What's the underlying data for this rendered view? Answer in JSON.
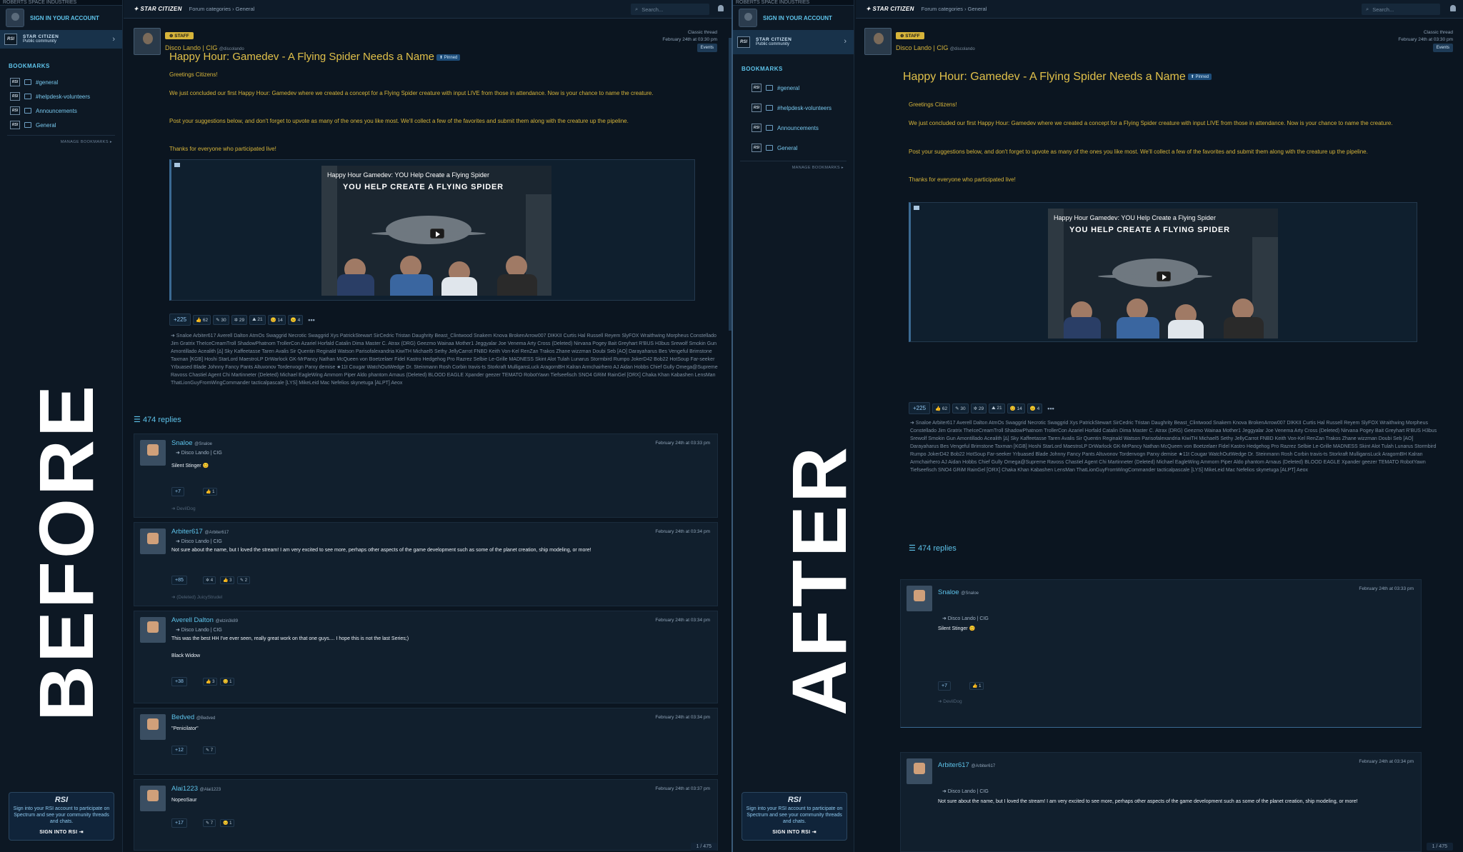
{
  "site": {
    "top": "ROBERTS SPACE INDUSTRIES",
    "signin": "SIGN IN YOUR ACCOUNT",
    "community_name": "STAR CITIZEN",
    "community_sub": "Public community",
    "rsi": "RSI"
  },
  "bookmarks": {
    "title": "BOOKMARKS",
    "items": [
      "#general",
      "#helpdesk-volunteers",
      "Announcements",
      "General"
    ],
    "manage": "MANAGE BOOKMARKS ▸"
  },
  "promo": {
    "logo": "RSI",
    "text": "Sign into your RSI account to participate on Spectrum and see your community threads and chats.",
    "button": "SIGN INTO RSI ⇥"
  },
  "labels": {
    "before": "BEFORE",
    "after": "AFTER"
  },
  "topbar": {
    "logo": "✦ STAR CITIZEN",
    "breadcrumbs": "Forum categories  ›  General",
    "search_placeholder": "Search..."
  },
  "thread": {
    "staff_badge": "⊕ STAFF",
    "author": "Disco Lando | CIG",
    "handle": "@discolando",
    "type": "Classic thread",
    "date": "February 24th at 03:30 pm",
    "tag": "Events",
    "title": "Happy Hour: Gamedev - A Flying Spider Needs a Name",
    "pinned": "⬆ Pinned",
    "greeting": "Greetings Citizens!",
    "p1": "We just concluded our first Happy Hour: Gamedev where we created a concept for a Flying Spider creature with input LIVE from those in attendance. Now is your chance to name the creature.",
    "p2": "Post your suggestions below, and don't forget to upvote as many of the ones you like most. We'll collect a few of the favorites and submit them along with the creature up the pipeline.",
    "p3": "Thanks for everyone who participated live!",
    "video_title": "Happy Hour Gamedev: YOU Help Create a Flying Spider",
    "video_subtitle": "YOU HELP CREATE A FLYING SPIDER",
    "votes": "+225",
    "reactions": [
      "👍 62",
      "✎ 30",
      "✲ 29",
      "⛰ 21",
      "😊 14",
      "😐 4"
    ],
    "more": "•••",
    "voters_before": "➜ Snaloe  Arbiter617  Averell Dalton  AtmOs  Swaggrid  Necrotic  Swaggrid  Xys  PatrickStewart  SirCedric  Tristan Daughrity  Beast_Clintwood  Snakem  Knova  BrokenArrow007  DIKKII  Curtis Hal  Russell Reyem  SlyFOX  Wraithwing  Morpheus  Constellado  Jim Gratrix  TheIceCreamTroll  ShadowPhatnom  TrollerCon  Azariel Horfald  Catalin Dima  Master C. Atrax (DRG)  Geezmo  Wainaa  Mother1  Jeggyalar  Joe Venema  Arty Cross  (Deleted)  Nirvana  Pogey Bait  Greyhart  R'BUS H3bus  Srewolf  Smokin Gun  Amontillado  Acealith  [∆] Sky  Kaffeetasse  Taren Avalis  Sir Quentin Reginald Watson  Parisofalexandria  KiwiTH  Michael5  Sethy  JellyCarrot  FNBD  Keith  Von-Kel  RenZan  Trakos  Zhane  wizzman  Doubi  Seb  [AO] Darayaharus  Bes Vengeful  Brimstone  Taxman [KGB]  Hoshi  StarLord  MaestroLP  DrWarlock  GK-MrPancy  Nathan McQueen  von Boetzelaer  Fidel Kastro  Hedgehog Pro  Razrez  Selbie Le-Grille  MADNESS  Skint Alot  Tulah Lunarus  Stormbird  Rumpo  JokerD42  Bob22  HotSoup  Far-seeker  Yrbuased  Blade  Johnny Fancy Pants  Altuvonov  Tordenvogn  Parxy  demise  ★11t Cougar  WatchOutWedge  Dr. Steinmann  Rosh Corbin  travis-ts  Storkraft  MulligansLuck  AragornBH  Kalran  Armchairhero  AJ  Aidan Hobbs  Chief Gully  Omega@Supreme  Ravoss  Chastiel  Agent Chi  Martinneter  (Deleted)  Michael  EagleWing  Ammorn  Piper  Aldo  phantom Arnaus  (Deleted)  BLOOD EAGLE  Xpander  geezer  TEMATO  RobotYawn  Tiefseefisch  SNO4  GRiM  RainGel  [ORX] Chaka Khan  Kabashen  LensMan  ThatLionGuyFromWingCommander  tacticalpascale  [LYS] MikeLeid  Mac  Nefelios  skynetuga [ALPT]  Aeox",
    "voters_after": "➜ Snaloe  Arbiter617  Averell Dalton  AtmOs  Swaggrid  Necrotic  Swaggrid  Xys  PatrickStewart  SirCedric  Tristan Daughrity  Beast_Clintwood  Snakem  Knova  BrokenArrow007  DIKKII  Curtis Hal  Russell Reyem  SlyFOX  Wraithwing  Morpheus  Constellado  Jim Gratrix  TheIceCreamTroll  ShadowPhatnom  TrollerCon  Azariel Horfald  Catalin Dima  Master C. Atrax (DRG)  Geezmo  Wainaa  Mother1  Jeggyalar  Joe Venema  Arty Cross  (Deleted)  Nirvana  Pogey Bait  Greyhart  R'BUS H3bus  Srewolf  Smokin Gun  Amontillado  Acealith  [∆] Sky  Kaffeetasse  Taren Avalis  Sir Quentin Reginald Watson  Parisofalexandria  KiwiTH  Michael5  Sethy  JellyCarrot  FNBD  Keith  Von-Kel  RenZan  Trakos  Zhane  wizzman  Doubi  Seb  [AO] Darayaharus  Bes Vengeful  Brimstone  Taxman [KGB]  Hoshi  StarLord  MaestroLP  DrWarlock  GK-MrPancy  Nathan McQueen  von Boetzelaer  Fidel Kastro  Hedgehog Pro  Razrez  Selbie Le-Grille  MADNESS  Skint Alot  Tulah Lunarus  Stormbird  Rumpo  JokerD42  Bob22  HotSoup  Far-seeker  Yrbuased  Blade  Johnny Fancy Pants  Altuvonov  Tordenvogn  Parxy  demise  ★11t Cougar  WatchOutWedge  Dr. Steinmann  Rosh Corbin  travis-ts  Storkraft  MulligansLuck  AragornBH  Kalran  Armchairhero  AJ  Aidan Hobbs  Chief Gully  Omega@Supreme  Ravoss  Chastiel  Agent Chi  Martinneter  (Deleted)  Michael  EagleWing  Ammorn  Piper  Aldo  phantom Arnaus  (Deleted)  BLOOD EAGLE  Xpander  geezer  TEMATO  RobotYawn  Tiefseefisch  SNO4  GRiM  RainGel  [ORX] Chaka Khan  Kabashen  LensMan  ThatLionGuyFromWingCommander  tacticalpascale  [LYS] MikeLeid  Mac  Nefelios  skynetuga [ALPT]  Aeox"
  },
  "replies_count": "474 replies",
  "replies": [
    {
      "name": "Snaloe",
      "handle": "@Snaloe",
      "date": "February 24th at 03:33 pm",
      "quote": "➜ Disco Lando | CIG",
      "text": "Silent Stinger 😊",
      "votes": "+7",
      "reactions": [
        "👍 1"
      ],
      "footer": "➜ DevilDog"
    },
    {
      "name": "Arbiter617",
      "handle": "@Arbiter617",
      "date": "February 24th at 03:34 pm",
      "quote": "➜ Disco Lando | CIG",
      "text": "Not sure about the name, but I loved the stream! I am very excited to see more, perhaps other aspects of the game development such as some of the planet creation, ship modeling, or more!",
      "votes": "+85",
      "reactions": [
        "✲ 4",
        "👍 3",
        "✎ 2"
      ],
      "footer": "➜ (Deleted)  JuicyStrudel"
    },
    {
      "name": "Averell Dalton",
      "handle": "@elzin3k89",
      "date": "February 24th at 03:34 pm",
      "quote": "➜ Disco Lando | CIG",
      "text": "This was the best HH I've ever seen, really great work on that one guys.... I hope this is not the last Series;)",
      "text2": "Black Widow",
      "votes": "+38",
      "reactions": [
        "👍 3",
        "😊 1"
      ],
      "footer": ""
    },
    {
      "name": "Bedved",
      "handle": "@Bedved",
      "date": "February 24th at 03:34 pm",
      "quote": "",
      "text": "\"Penicilator\"",
      "votes": "+12",
      "reactions": [
        "✎ 7"
      ],
      "footer": ""
    },
    {
      "name": "Alai1223",
      "handle": "@Alai1223",
      "date": "February 24th at 03:37 pm",
      "quote": "",
      "text": "NopeoSaur",
      "votes": "+17",
      "reactions": [
        "✎ 7",
        "😊 1"
      ],
      "footer": ""
    }
  ],
  "pager": "1 / 475",
  "pager_after": "1 / 475"
}
